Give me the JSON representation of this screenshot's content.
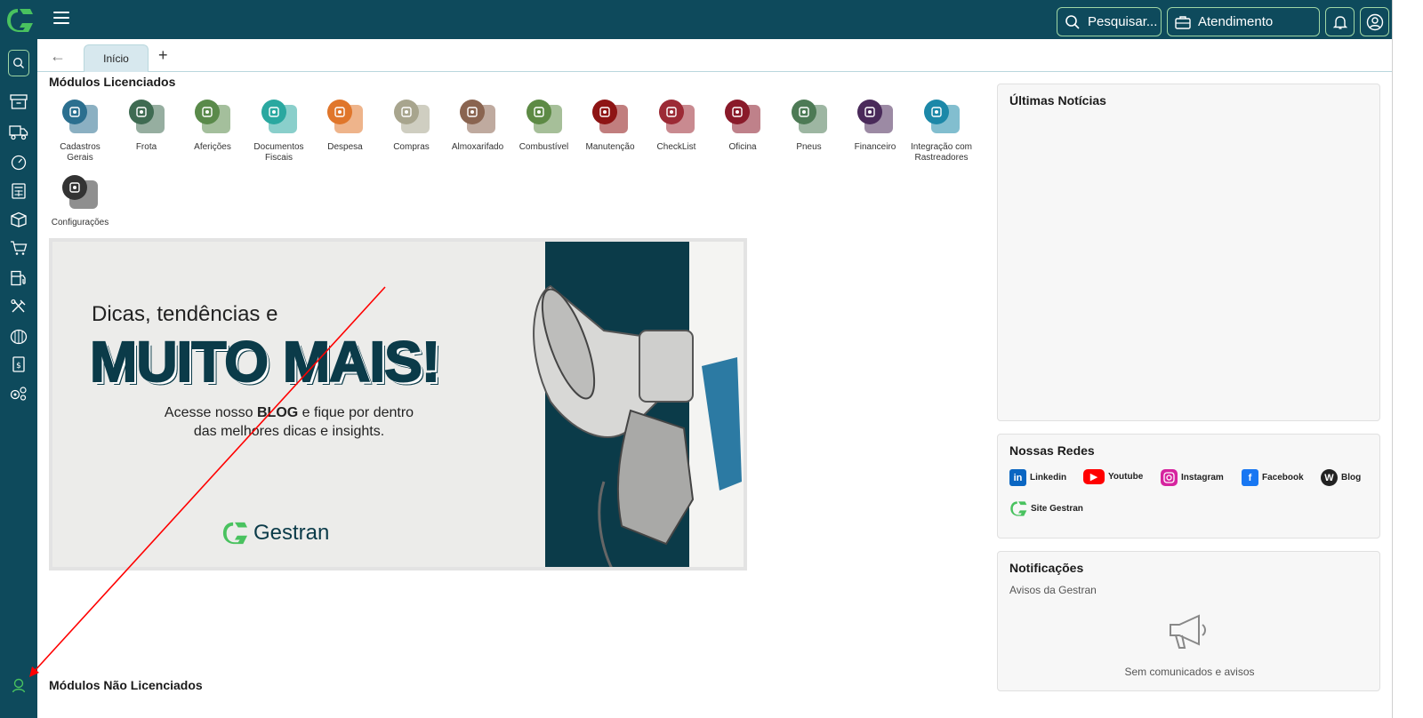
{
  "header": {
    "search_label": "Pesquisar...",
    "support_label": "Atendimento"
  },
  "tabs": {
    "active": "Início"
  },
  "modules": {
    "title": "Módulos Licenciados",
    "items": [
      {
        "label": "Cadastros Gerais",
        "color": "#2b6f8f"
      },
      {
        "label": "Frota",
        "color": "#3f6b52"
      },
      {
        "label": "Aferições",
        "color": "#5a8a4a"
      },
      {
        "label": "Documentos Fiscais",
        "color": "#2aa8a0"
      },
      {
        "label": "Despesa",
        "color": "#e0762b"
      },
      {
        "label": "Compras",
        "color": "#a8a58e"
      },
      {
        "label": "Almoxarifado",
        "color": "#8a6450"
      },
      {
        "label": "Combustível",
        "color": "#5d8a45"
      },
      {
        "label": "Manutenção",
        "color": "#8e1414"
      },
      {
        "label": "CheckList",
        "color": "#9c2a35"
      },
      {
        "label": "Oficina",
        "color": "#8a1a2a"
      },
      {
        "label": "Pneus",
        "color": "#4d7a55"
      },
      {
        "label": "Financeiro",
        "color": "#4a2a5a"
      },
      {
        "label": "Integração com Rastreadores",
        "color": "#1c88a8"
      },
      {
        "label": "Configurações",
        "color": "#333333"
      }
    ],
    "not_licensed_title": "Módulos Não Licenciados"
  },
  "banner": {
    "line1": "Dicas, tendências e",
    "line2": "MUITO MAIS!",
    "line3_pre": "Acesse nosso ",
    "line3_bold": "BLOG",
    "line3_post": " e fique por dentro",
    "line4": "das melhores dicas e insights.",
    "brand": "Gestran"
  },
  "news": {
    "title": "Últimas Notícias"
  },
  "social": {
    "title": "Nossas Redes",
    "items": [
      {
        "label": "Linkedin",
        "icon": "linkedin-icon",
        "color": "#0a66c2"
      },
      {
        "label": "Youtube",
        "icon": "youtube-icon",
        "color": "#ff0000"
      },
      {
        "label": "Instagram",
        "icon": "instagram-icon",
        "color": "#d6249f"
      },
      {
        "label": "Facebook",
        "icon": "facebook-icon",
        "color": "#1877f2"
      },
      {
        "label": "Blog",
        "icon": "wordpress-icon",
        "color": "#222222"
      },
      {
        "label": "Site Gestran",
        "icon": "gestran-icon",
        "color": "#49c25f"
      }
    ]
  },
  "notifications": {
    "title": "Notificações",
    "subtitle": "Avisos da Gestran",
    "empty_text": "Sem comunicados e avisos"
  },
  "colors": {
    "primary_dark": "#0e4a5c",
    "accent_green": "#49c25f",
    "annotation_red": "#ff0000"
  }
}
